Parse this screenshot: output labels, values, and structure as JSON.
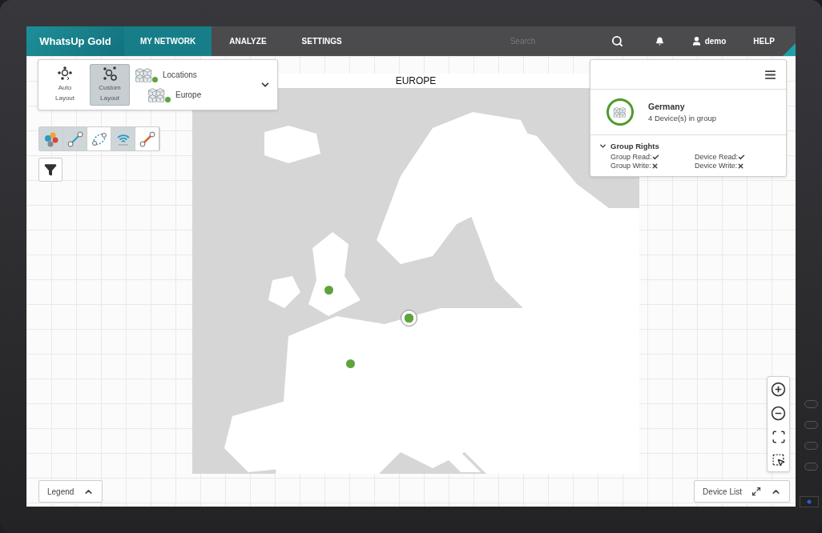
{
  "app": {
    "logo": "WhatsUp Gold"
  },
  "nav": {
    "tabs": [
      {
        "label": "MY NETWORK",
        "selected": true
      },
      {
        "label": "ANALYZE",
        "selected": false
      },
      {
        "label": "SETTINGS",
        "selected": false
      }
    ],
    "search": {
      "placeholder": "Search"
    },
    "user": "demo",
    "help": "HELP"
  },
  "layout_panel": {
    "modes": [
      {
        "kind": "auto",
        "label": "Auto Layout",
        "selected": false
      },
      {
        "kind": "custom",
        "label": "Custom Layout",
        "selected": true
      }
    ],
    "breadcrumb": [
      {
        "label": "Locations"
      },
      {
        "label": "Europe"
      }
    ]
  },
  "tools": [
    {
      "kind": "groups",
      "selected": true
    },
    {
      "kind": "link",
      "selected": true
    },
    {
      "kind": "ring",
      "selected": false
    },
    {
      "kind": "wireless",
      "selected": true
    },
    {
      "kind": "alert-link",
      "selected": false
    }
  ],
  "map": {
    "title": "EUROPE",
    "pins": [
      {
        "selected": false
      },
      {
        "selected": true
      },
      {
        "selected": false
      }
    ]
  },
  "info": {
    "name": "Germany",
    "count": "4 Device(s) in group",
    "section": {
      "title": "Group Rights",
      "expanded": true,
      "rights": [
        {
          "label": "Group Read:",
          "allowed": true
        },
        {
          "label": "Device Read:",
          "allowed": true
        },
        {
          "label": "Group Write:",
          "allowed": false
        },
        {
          "label": "Device Write:",
          "allowed": false
        }
      ]
    }
  },
  "legend": {
    "label": "Legend"
  },
  "device_list": {
    "label": "Device List"
  }
}
